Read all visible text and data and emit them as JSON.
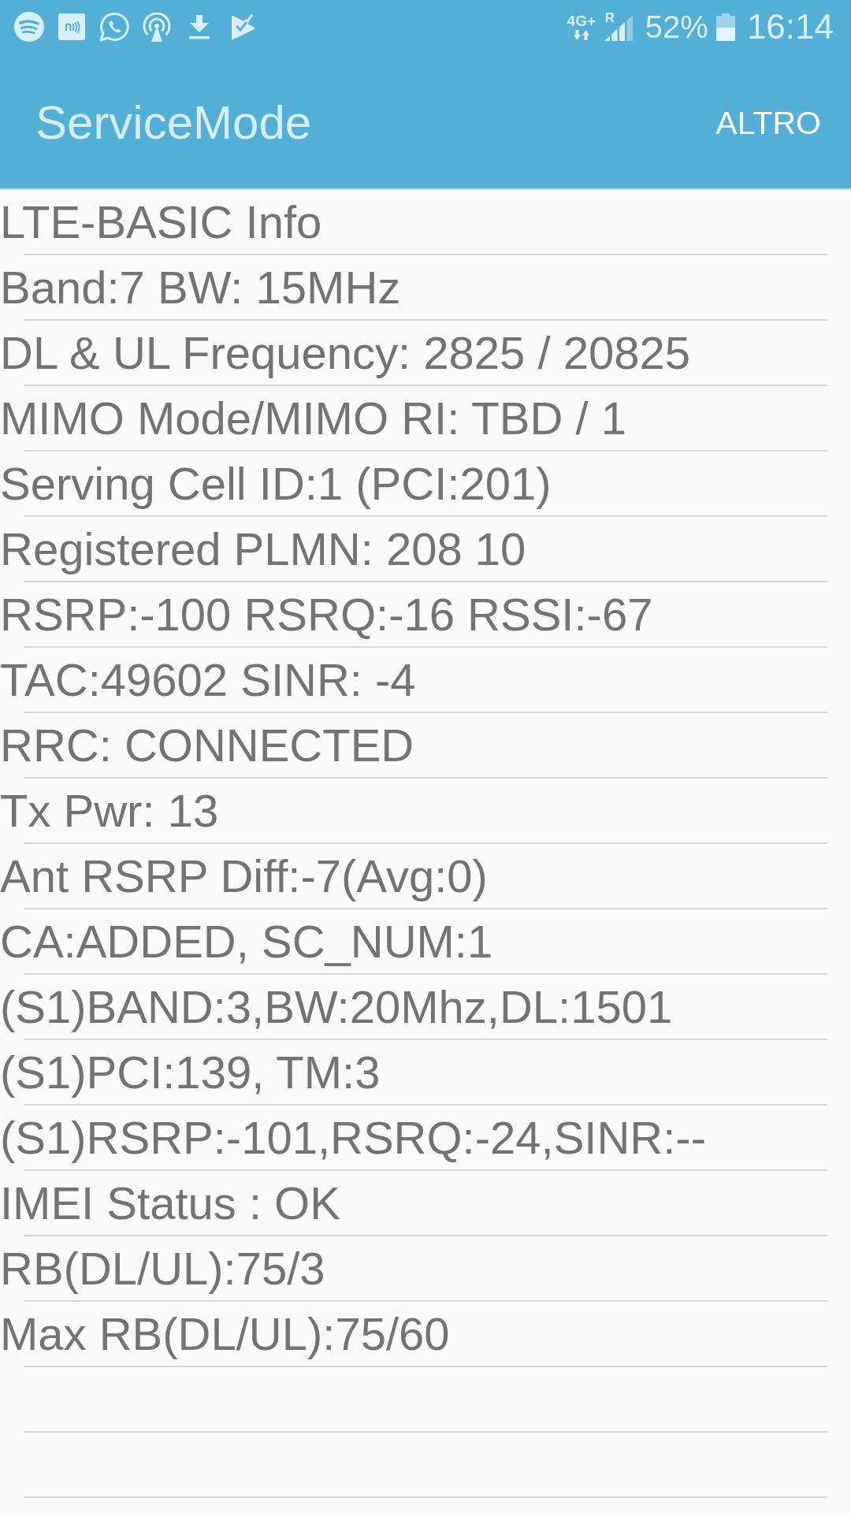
{
  "status_bar": {
    "network_type": "4G+",
    "roaming": "R",
    "battery_percent": "52%",
    "time": "16:14"
  },
  "app_bar": {
    "title": "ServiceMode",
    "menu_button": "ALTRO"
  },
  "info_rows": [
    "LTE-BASIC Info",
    "Band:7 BW: 15MHz",
    "DL & UL Frequency: 2825 / 20825",
    "MIMO Mode/MIMO RI: TBD / 1",
    "Serving Cell ID:1 (PCI:201)",
    "Registered PLMN: 208 10",
    "RSRP:-100 RSRQ:-16 RSSI:-67",
    "TAC:49602 SINR: -4",
    "RRC: CONNECTED",
    "Tx Pwr: 13",
    "Ant RSRP Diff:-7(Avg:0)",
    "CA:ADDED, SC_NUM:1",
    "(S1)BAND:3,BW:20Mhz,DL:1501",
    "(S1)PCI:139, TM:3",
    "(S1)RSRP:-101,RSRQ:-24,SINR:--",
    "IMEI Status : OK",
    "RB(DL/UL):75/3",
    "Max RB(DL/UL):75/60"
  ]
}
